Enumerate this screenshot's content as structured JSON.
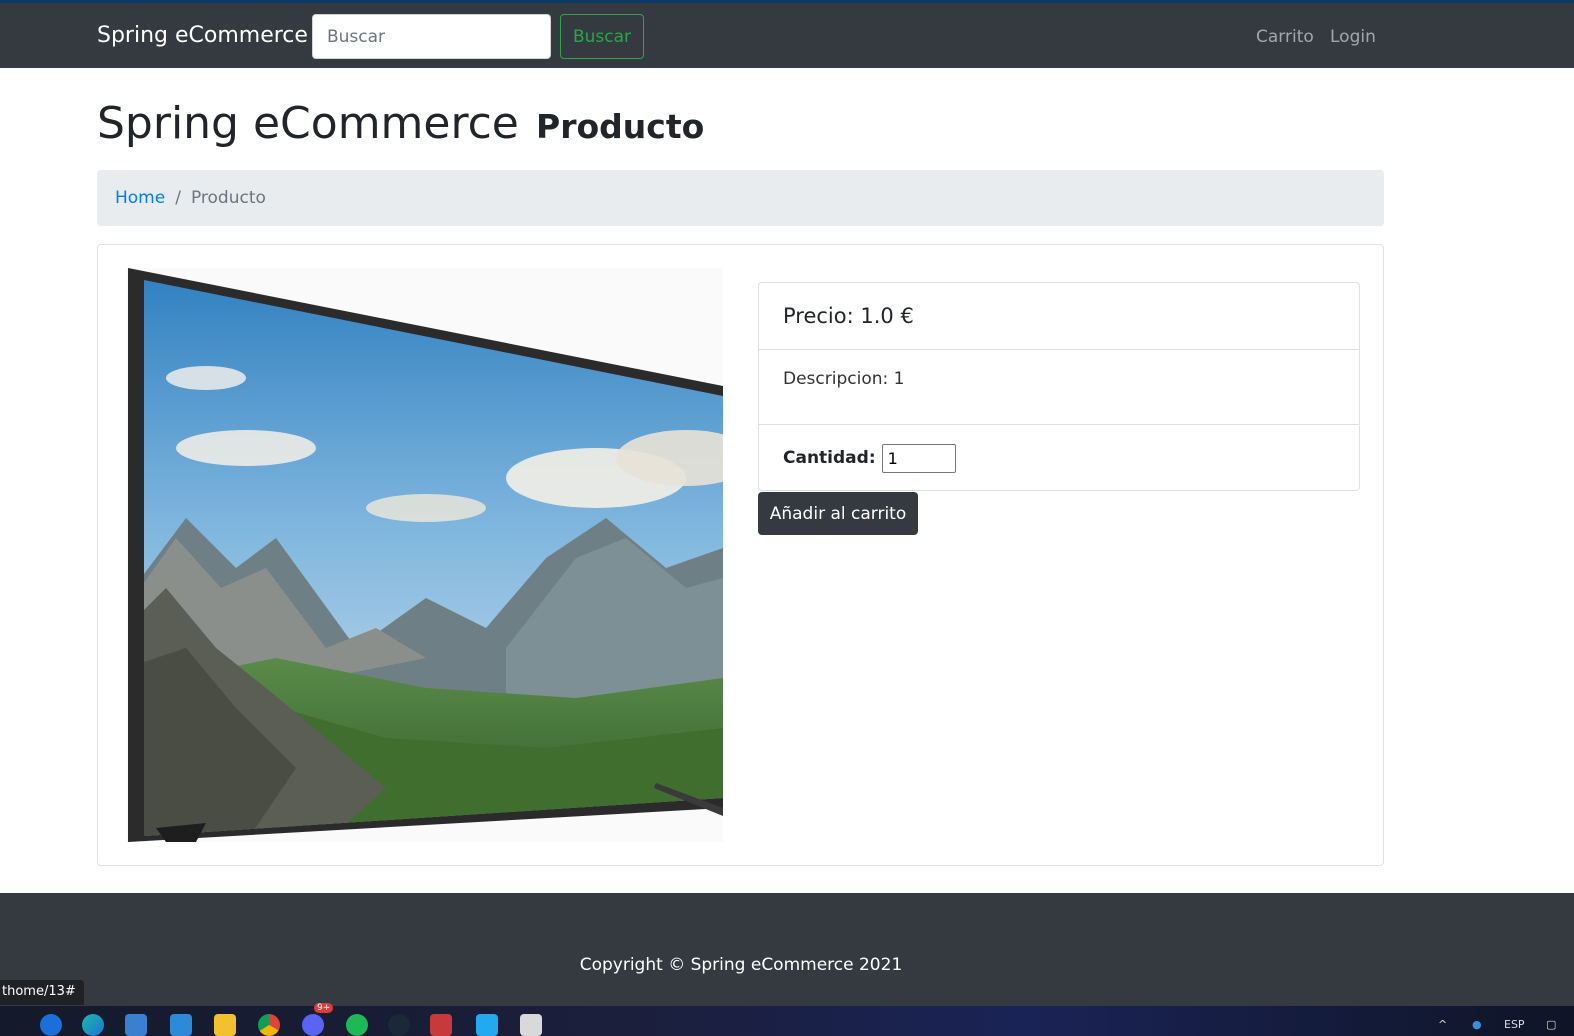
{
  "navbar": {
    "brand": "Spring eCommerce",
    "search_placeholder": "Buscar",
    "search_button": "Buscar",
    "links": [
      "Carrito",
      "Login"
    ]
  },
  "page": {
    "title": "Spring eCommerce",
    "subtitle": "Producto"
  },
  "breadcrumb": {
    "home": "Home",
    "separator": "/",
    "current": "Producto"
  },
  "product": {
    "image_alt": "television",
    "price_text": "Precio: 1.0 €",
    "description_text": "Descripcion: 1",
    "quantity_label": "Cantidad:",
    "quantity_value": "1",
    "add_button": "Añadir al carrito"
  },
  "footer": {
    "copyright": "Copyright © Spring eCommerce 2021"
  },
  "status_bar": {
    "url_fragment": "thome/13#"
  },
  "taskbar": {
    "icons": [
      "bing-icon",
      "edge-icon",
      "photos-icon",
      "store-icon",
      "folder-icon",
      "chrome-icon",
      "discord-icon",
      "spotify-icon",
      "steam-icon",
      "app-icon",
      "vscode-icon",
      "app2-icon"
    ],
    "discord_badge": "9+",
    "language": "ESP"
  },
  "colors": {
    "navbar_bg": "#343a40",
    "success": "#28a745",
    "link": "#007bff",
    "breadcrumb_bg": "#e9ecef"
  }
}
